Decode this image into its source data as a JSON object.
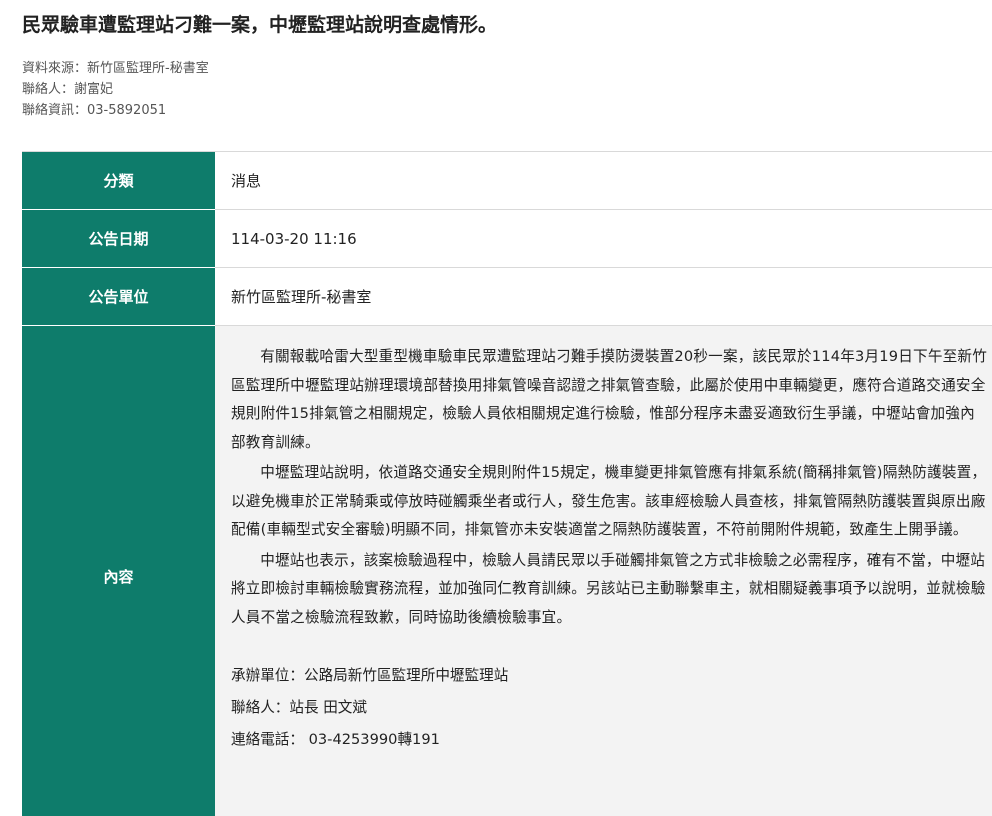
{
  "article": {
    "title": "民眾驗車遭監理站刁難一案，中壢監理站說明查處情形。",
    "meta": {
      "source": "資料來源：新竹區監理所-秘書室",
      "contact_person": "聯絡人：謝富妃",
      "contact_info": "聯絡資訊：03-5892051"
    }
  },
  "table": {
    "category_label": "分類",
    "category_value": "消息",
    "date_label": "公告日期",
    "date_value": "114-03-20 11:16",
    "unit_label": "公告單位",
    "unit_value": "新竹區監理所-秘書室",
    "content_label": "內容",
    "content": {
      "paragraphs": [
        "有關報載哈雷大型重型機車驗車民眾遭監理站刁難手摸防燙裝置20秒一案，該民眾於114年3月19日下午至新竹區監理所中壢監理站辦理環境部替換用排氣管噪音認證之排氣管查驗，此屬於使用中車輛變更，應符合道路交通安全規則附件15排氣管之相關規定，檢驗人員依相關規定進行檢驗，惟部分程序未盡妥適致衍生爭議，中壢站會加強內部教育訓練。",
        "中壢監理站說明，依道路交通安全規則附件15規定，機車變更排氣管應有排氣系統(簡稱排氣管)隔熱防護裝置，以避免機車於正常騎乘或停放時碰觸乘坐者或行人，發生危害。該車經檢驗人員查核，排氣管隔熱防護裝置與原出廠配備(車輛型式安全審驗)明顯不同，排氣管亦未安裝適當之隔熱防護裝置，不符前開附件規範，致產生上開爭議。",
        "中壢站也表示，該案檢驗過程中，檢驗人員請民眾以手碰觸排氣管之方式非檢驗之必需程序，確有不當，中壢站將立即檢討車輛檢驗實務流程，並加強同仁教育訓練。另該站已主動聯繫車主，就相關疑義事項予以說明，並就檢驗人員不當之檢驗流程致歉，同時協助後續檢驗事宜。"
      ],
      "handling_unit": "承辦單位：公路局新竹區監理所中壢監理站",
      "contact": "聯絡人：站長 田文斌",
      "phone": "連絡電話： 03-4253990轉191"
    }
  }
}
